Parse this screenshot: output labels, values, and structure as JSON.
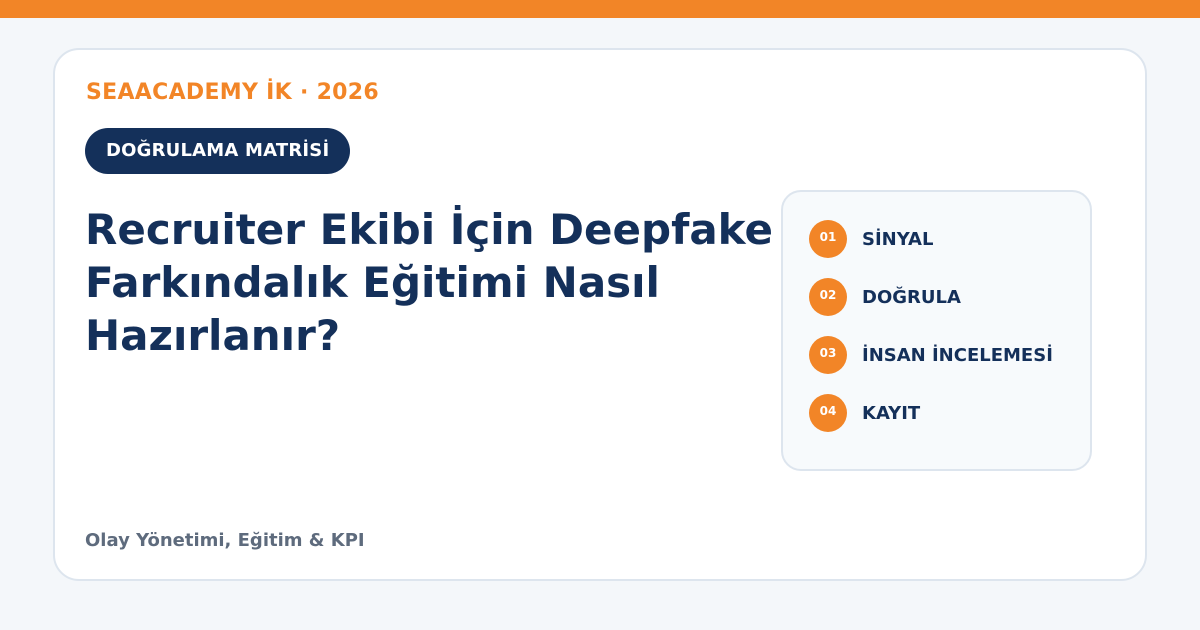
{
  "brand": "SEAACADEMY İK · 2026",
  "badge": "DOĞRULAMA MATRİSİ",
  "title_lines": [
    "Recruiter Ekibi İçin Deepfake",
    "Farkındalık Eğitimi Nasıl",
    "Hazırlanır?"
  ],
  "footer": "Olay Yönetimi, Eğitim & KPI",
  "steps": [
    {
      "num": "01",
      "label": "SİNYAL"
    },
    {
      "num": "02",
      "label": "DOĞRULA"
    },
    {
      "num": "03",
      "label": "İNSAN İNCELEMESİ"
    },
    {
      "num": "04",
      "label": "KAYIT"
    }
  ],
  "colors": {
    "accent": "#f28527",
    "navy": "#14305a",
    "muted": "#5e6b7d",
    "background": "#f4f7fa"
  }
}
